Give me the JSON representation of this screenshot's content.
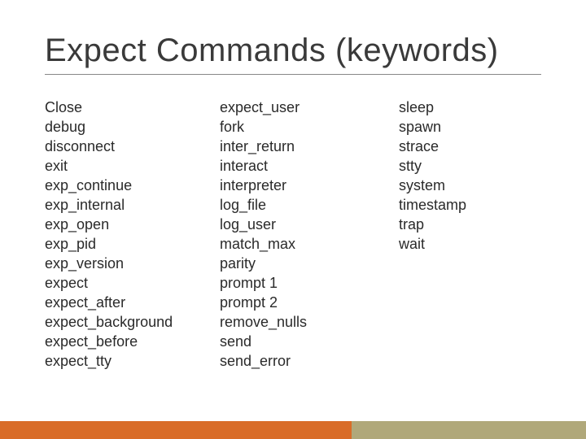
{
  "title": "Expect Commands (keywords)",
  "columns": [
    {
      "items": [
        "Close",
        "debug",
        "disconnect",
        "exit",
        "exp_continue",
        "exp_internal",
        "exp_open",
        "exp_pid",
        "exp_version",
        "expect",
        "expect_after",
        "expect_background",
        "expect_before",
        "expect_tty"
      ]
    },
    {
      "items": [
        "expect_user",
        "fork",
        "inter_return",
        "interact",
        "interpreter",
        "log_file",
        "log_user",
        "match_max",
        "parity",
        "prompt 1",
        "prompt 2",
        "remove_nulls",
        "send",
        "send_error"
      ]
    },
    {
      "items": [
        "sleep",
        "spawn",
        "strace",
        "stty",
        "system",
        "timestamp",
        "trap",
        "wait"
      ]
    }
  ],
  "colors": {
    "footer_left": "#d96c28",
    "footer_right": "#b0a87a"
  }
}
